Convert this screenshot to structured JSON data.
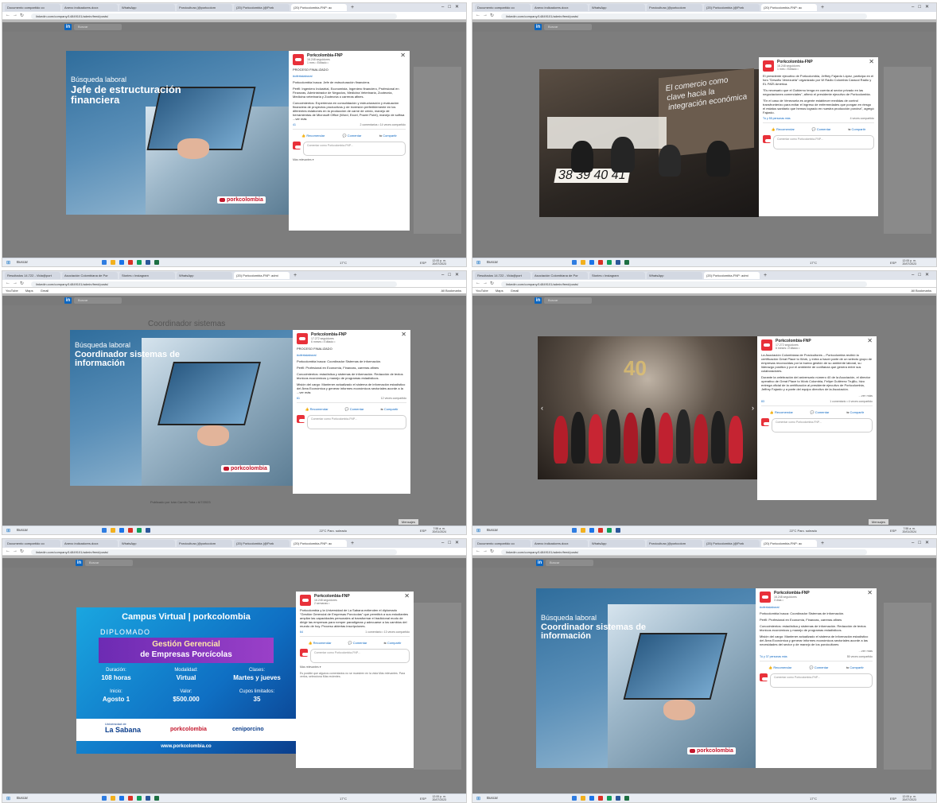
{
  "tabs": {
    "docs": "Documento compartido co",
    "anexo": "Anexo indicadores.docx",
    "whatsapp": "WhatsApp",
    "porcicultura": "Porcicultura (@porkcolom",
    "twitter": "(20) Porkcolombia (@Pork",
    "linkedin": "(20) Porkcolombia-FNP: ac",
    "resultados": "Resultados 14.722 - Vida@port",
    "asociacion": "Asociación Colombiana de Por",
    "stories": "Stories • Instagram",
    "linkedin_b": "(20) Porkcolombia-FNP: admi"
  },
  "browser": {
    "url": "linkedin.com/company/14849101/admin/feed/posts/",
    "bookmarks": [
      "YouTube",
      "Maps",
      "Gmail"
    ],
    "all_bookmarks": "All Bookmarks"
  },
  "linkedin": {
    "search": "Buscar",
    "logo": "in",
    "nav": [
      "Inicio",
      "Mi red",
      "Empleos",
      "Mensajes",
      "Notificaciones",
      "Yo",
      "Para negocios"
    ]
  },
  "taskbar": {
    "search": "Buscar",
    "weather_a": "17°C",
    "weather_b": "22°C Parc. soleado",
    "lang": "ESP",
    "time_a": "12:00 p. m.",
    "date_a": "20/07/2023",
    "time_b": "7:55 a. m.",
    "date_b": "20/01/2024"
  },
  "posts": {
    "org": "Porkcolombia-FNP",
    "followers": "16.248 seguidores",
    "followers_b": "17.272 seguidores",
    "age_1": "1 mes • Editado •",
    "age_2": "6 meses • Editado •",
    "age_3": "2 semanas •",
    "age_4": "3 días •",
    "recommend": "Recomendar",
    "comment": "Comentar",
    "share": "Compartir",
    "comment_placeholder": "Comentar como Porkcolombia-FNP...",
    "most_relevant": "Más relevantes ▾",
    "see_more": "...ver más",
    "brand": "porkcolombia"
  },
  "shot0": {
    "ad_small": "Búsqueda laboral",
    "ad_big": "Jefe de estructuración financiera",
    "p1": "PROCESO FINALIZADO",
    "tag": "#ofertalaboral",
    "p2": "Porkcolombia busca: Jefe de estructuración financiera.",
    "p3": "Perfil: Ingeniero Industrial, Economista, Ingeniero financiero, Profesional en Finanzas, Administrador de Negocios, Medicina Veterinaria, Zootecnia, Medicina veterinaria y Zootecnia o carreras afines.",
    "p4": "Conocimientos: Experiencia en consolidación y estructuración y evaluación financiera de proyectos productivos y de inversión preferiblemente en los diferentes eslabones en la producción de carne de cerdo, manejo de herramientas de Microsoft Office (Word, Excel, Power Point), manejo de softwa ...ver más",
    "stats_left": "41",
    "stats_right": "2 comentarios • 14 veces compartido"
  },
  "shot1": {
    "p1": "El presidente ejecutivo de Porkcolombia, Jeffrey Fajardo López, participa en el foro \"Desafío Venezuela\" organizado por W Radio Colombia Caracol Radio y EL PAÍS América.",
    "p2": "\"Es necesario que el Gobierno tenga en cuenta al sector privado en las negociaciones comerciales\", afirmó el presidente ejecutivo de Porkcolombia.",
    "p3": "\"En el caso de Venezuela es urgente establecer medidas de control transfronterizo para evitar el ingreso de enfermedades que pongan en riesgo el estatus sanitario que hemos logrado en nuestra producción porcina\", agregó Fajardo.",
    "stats_left": "Tú y 55 personas más",
    "stats_right": "4 veces compartido",
    "photo_sign": "El comercio como clave hacia la integración económica"
  },
  "shot2": {
    "ad_small": "Búsqueda laboral",
    "ad_big": "Coordinador sistemas de información",
    "p1": "PROCESO FINALIZADO",
    "tag": "#ofertalaboral",
    "p2": "Porkcolombia busca: Coordinador Sistemas de información.",
    "p3": "Perfil: Profesional en Economía, Finanzas, carreras afines",
    "p4": "Conocimientos: estadística y sistemas de información. Redacción de textos técnicos económicos y manejo de programas estadísticos.",
    "p5": "Misión del cargo: Mantener actualizado el sistema de información estadístico del Área Económica y generar informes económicos sectoriales acorde a la ...ver más",
    "stats_left": "61",
    "stats_right": "12 veces compartido",
    "published": "Publicado por Iván Camilo Toba • 6/7/2023",
    "header_ghost": "Coordinador sistemas",
    "messages": "Mensajes"
  },
  "shot3": {
    "p1": "La Asociación Colombiana de Porcicultores – Porkcolombia recibió la certificación Great Place to Work, y entra a hacer parte de un selecto grupo de empresas reconocidas por la buena gestión de su ambiente laboral, su liderazgo positivo y por el ambiente de confianza que genera entre sus colaboradores.",
    "p2": "Durante la celebración del aniversario número 40 de la Asociación, el director operativo de Great Place to Work Colombia, Felipe Gutiérrez Trujillo, hizo entrega oficial de la certificación al presidente ejecutivo de Porkcolombia, Jeffrey Fajardo y a parte del equipo directivo de la Asociación.",
    "stats_left": "83",
    "stats_right": "1 comentario • 4 veces compartido",
    "messages": "Mensajes"
  },
  "shot4": {
    "campus": "Campus Virtual",
    "campus_brand": "porkcolombia",
    "diplomado": "DIPLOMADO",
    "title1": "Gestión Gerencial",
    "title2": "de Empresas Porcícolas",
    "dur_l": "Duración:",
    "dur_v": "108 horas",
    "mod_l": "Modalidad:",
    "mod_v": "Virtual",
    "cls_l": "Clases:",
    "cls_v": "Martes y jueves",
    "ini_l": "Inicio:",
    "ini_v": "Agosto 1",
    "val_l": "Valor:",
    "val_v": "$500.000",
    "cup_l": "Cupos limitados:",
    "cup_v": "35",
    "sabana_small": "Universidad de",
    "sabana": "La Sabana",
    "ceniporcino": "ceniporcino",
    "web": "www.porkcolombia.co",
    "p1": "Porkcolombia y la Universidad de La Sabana extienden el diplomado \"Gestión Gerencial de Empresas Porcícolas\" que permitirá a sus estudiantes ampliar las capacidades personales al transformar el tradicional modo de dirigir las empresas para romper paradigmas y adecuarse a los cambios del mundo de hoy. Proceso abiertas inscripciones.",
    "stats_left": "64",
    "stats_right": "1 comentario • 13 veces compartido",
    "note": "Es posible que algunos comentarios no se muestren en la vista Más relevantes. Para verlos, selecciona Más recientes."
  },
  "shot5": {
    "ad_small": "Búsqueda laboral",
    "ad_big": "Coordinador sistemas de información",
    "tag": "#ofertalaboral",
    "p2": "Porkcolombia busca: Coordinador Sistemas de información.",
    "p3": "Perfil: Profesional en Economía, Finanzas, carreras afines",
    "p4": "Conocimientos: estadística y sistemas de información. Redacción de textos técnicos económicos y manejo de programas estadísticos.",
    "p5": "Misión del cargo: Mantener actualizado el sistema de información estadístico del Área Económica y generar informes económicos sectoriales acorde a las necesidades del sector y de manejo de los porcicultores",
    "stats_left": "Tú y 37 personas más",
    "stats_right": "55 veces compartido"
  },
  "colors": {
    "linkedin_blue": "#0a66c2",
    "brand_red": "#c4172c"
  }
}
